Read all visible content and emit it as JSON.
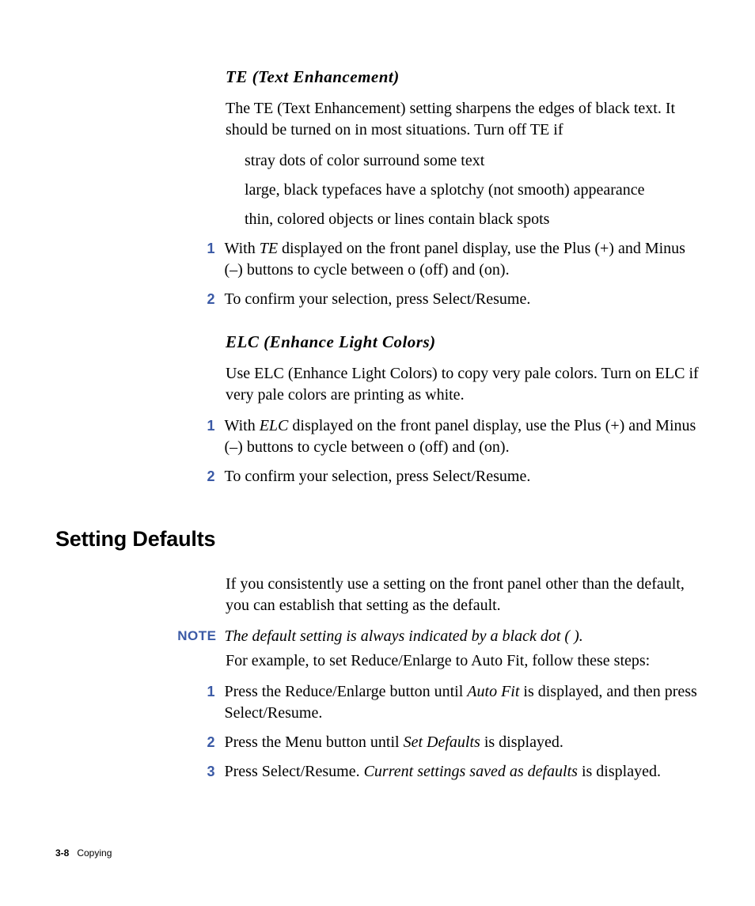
{
  "sections": {
    "te": {
      "heading": "TE (Text Enhancement)",
      "intro": "The TE (Text Enhancement) setting sharpens the edges of black text. It should be turned on in most situations. Turn off TE if",
      "bullets": [
        "stray dots of color surround some text",
        "large, black typefaces have a splotchy (not smooth) appearance",
        "thin, colored objects or lines contain black spots"
      ],
      "steps": [
        {
          "num": "1",
          "pre": "With ",
          "em": "TE",
          "post": " displayed on the front panel display, use the Plus (+) and Minus (–) buttons to cycle between o (off) and    (on)."
        },
        {
          "num": "2",
          "text": "To confirm your selection, press Select/Resume."
        }
      ]
    },
    "elc": {
      "heading": "ELC (Enhance Light Colors)",
      "intro": "Use ELC (Enhance Light Colors) to copy very pale colors. Turn on ELC if very pale colors are printing as white.",
      "steps": [
        {
          "num": "1",
          "pre": "With ",
          "em": "ELC",
          "post": " displayed on the front panel display, use the Plus (+) and Minus (–) buttons to cycle between o (off) and    (on)."
        },
        {
          "num": "2",
          "text": "To confirm your selection, press Select/Resume."
        }
      ]
    },
    "defaults": {
      "heading": "Setting Defaults",
      "intro": "If you consistently use a setting on the front panel other than the default, you can establish that setting as the default.",
      "note_label": "NOTE",
      "note_text": "The default setting is always indicated by a black dot (  ).",
      "example": "For example, to set Reduce/Enlarge to Auto Fit, follow these steps:",
      "steps": [
        {
          "num": "1",
          "pre": "Press the Reduce/Enlarge button until ",
          "em": "Auto Fit",
          "post": " is displayed, and then press Select/Resume."
        },
        {
          "num": "2",
          "pre": "Press the Menu button until ",
          "em": "Set Defaults",
          "post": " is displayed."
        },
        {
          "num": "3",
          "pre": "Press Select/Resume. ",
          "em": "Current settings saved as defaults",
          "post": " is displayed."
        }
      ]
    }
  },
  "footer": {
    "page": "3-8",
    "chapter": "Copying"
  }
}
